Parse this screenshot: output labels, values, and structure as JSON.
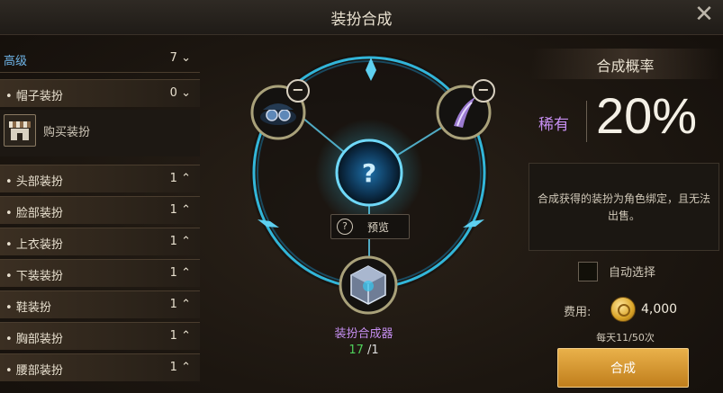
{
  "window": {
    "title": "装扮合成",
    "close_glyph": "✕"
  },
  "left_panel": {
    "grade": {
      "label": "高级",
      "value": "7"
    },
    "hat_row": {
      "label": "帽子装扮",
      "value": "0"
    },
    "buy": {
      "label": "购买装扮",
      "icon": "shop-icon"
    },
    "rows": [
      {
        "label": "头部装扮",
        "value": "1"
      },
      {
        "label": "脸部装扮",
        "value": "1"
      },
      {
        "label": "上衣装扮",
        "value": "1"
      },
      {
        "label": "下装装扮",
        "value": "1"
      },
      {
        "label": "鞋装扮",
        "value": "1"
      },
      {
        "label": "胸部装扮",
        "value": "1"
      },
      {
        "label": "腰部装扮",
        "value": "1"
      }
    ]
  },
  "center": {
    "preview": {
      "label": "预览",
      "icon": "question-magnifier-icon"
    },
    "result_slot_glyph": "?",
    "crafter": {
      "name": "装扮合成器",
      "owned": "17",
      "separator": "/",
      "required": "1"
    }
  },
  "right_panel": {
    "prob_title": "合成概率",
    "rarity": "稀有",
    "probability": "20%",
    "info": "合成获得的装扮为角色绑定，且无法出售。",
    "auto_select": {
      "label": "自动选择",
      "checked": false
    },
    "fee": {
      "label": "费用:",
      "value": "4,000",
      "icon": "gold-coin-icon"
    },
    "daily_limit": "每天11/50次",
    "craft_button": "合成"
  },
  "colors": {
    "grade_blue": "#6fb5e8",
    "rarity_purple": "#c58ef0",
    "count_green": "#4fd05a",
    "button_gold": "#d9982e",
    "glow_cyan": "#35c8f0"
  }
}
